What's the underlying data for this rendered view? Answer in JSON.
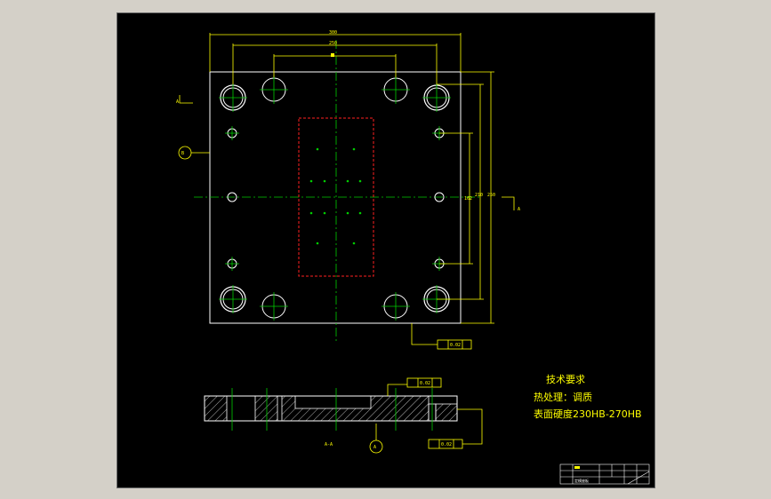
{
  "drawing": {
    "technical_requirements": {
      "title": "技术要求",
      "line1": "热处理：调质",
      "line2": "表面硬度230HB-270HB"
    },
    "section_label_top": "A",
    "section_label_right": "A",
    "section_view_label": "A-A",
    "balloon_top": "B",
    "balloon_bottom": "A",
    "dimension_top_1": "300",
    "dimension_top_2": "250",
    "dimension_top_3": "210",
    "dimension_right_1": "250",
    "dimension_right_2": "210",
    "dimension_right_3": "162",
    "tolerance_frame_1": "0.02",
    "tolerance_frame_2": "0.02",
    "tolerance_frame_3": "0.02",
    "title_block_label": "定模座板"
  },
  "colors": {
    "background": "#000000",
    "outline": "#ffffff",
    "center_line": "#00cc00",
    "dimension": "#ffff00",
    "cavity_outline": "#ff0000"
  }
}
